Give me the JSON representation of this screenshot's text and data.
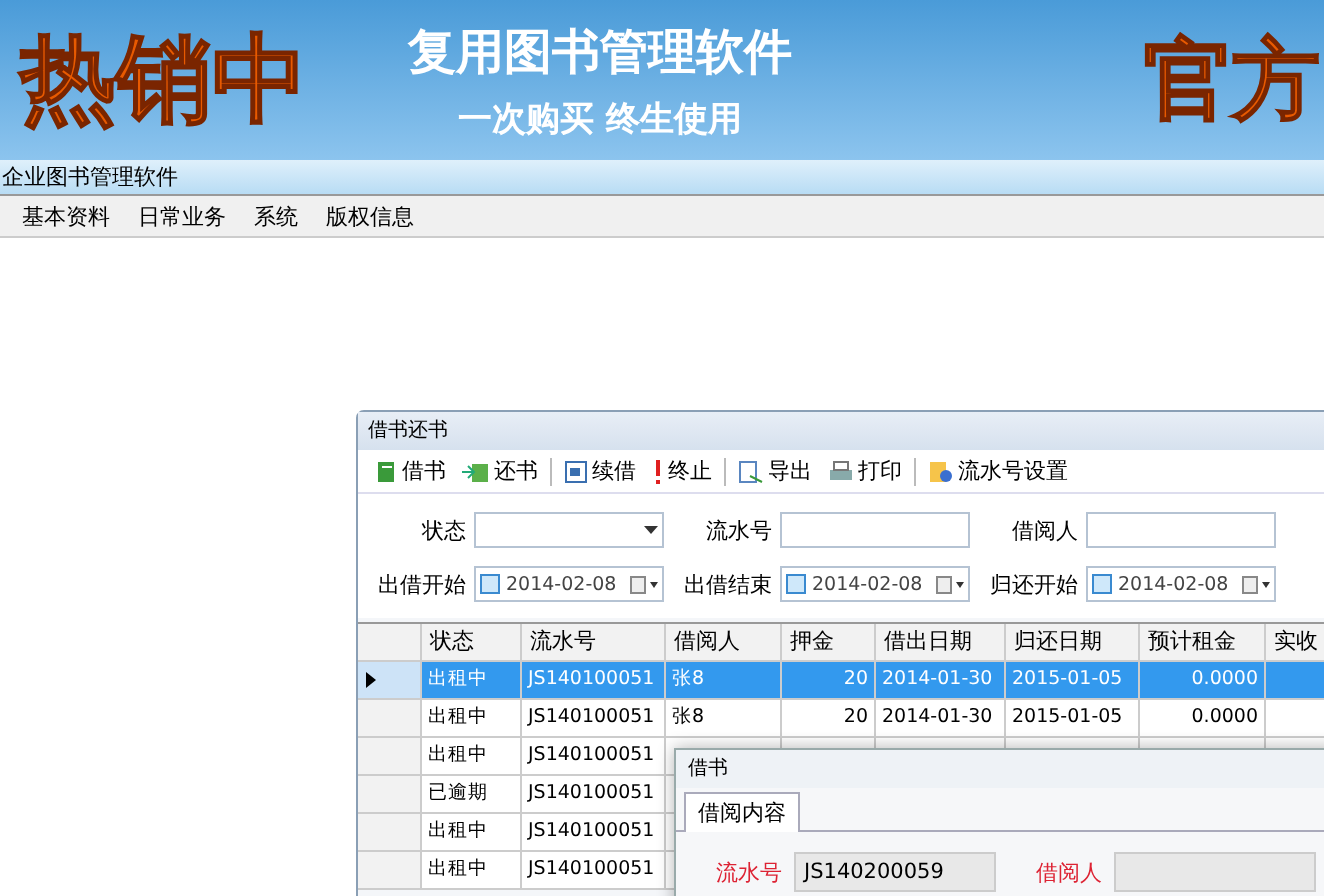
{
  "banner": {
    "slogan": "热销中",
    "title": "复用图书管理软件",
    "subtitle": "一次购买 终生使用",
    "badge": "官方"
  },
  "app_title": "企业图书管理软件",
  "menu": [
    "基本资料",
    "日常业务",
    "系统",
    "版权信息"
  ],
  "window": {
    "title": "借书还书",
    "toolbar": [
      {
        "label": "借书",
        "separator_after": false
      },
      {
        "label": "还书",
        "separator_after": true
      },
      {
        "label": "续借",
        "separator_after": false
      },
      {
        "label": "终止",
        "separator_after": true
      },
      {
        "label": "导出",
        "separator_after": false
      },
      {
        "label": "打印",
        "separator_after": true
      },
      {
        "label": "流水号设置",
        "separator_after": false
      }
    ],
    "filters": [
      {
        "label": "状态",
        "kind": "combo"
      },
      {
        "label": "流水号",
        "kind": "text"
      },
      {
        "label": "借阅人",
        "kind": "text"
      },
      {
        "label": "出借开始",
        "kind": "date",
        "value": "2014-02-08"
      },
      {
        "label": "出借结束",
        "kind": "date",
        "value": "2014-02-08"
      },
      {
        "label": "归还开始",
        "kind": "date",
        "value": "2014-02-08"
      }
    ],
    "table": {
      "columns": [
        "状态",
        "流水号",
        "借阅人",
        "押金",
        "借出日期",
        "归还日期",
        "预计租金",
        "实收"
      ],
      "rows": [
        {
          "selected": true,
          "cells": [
            "出租中",
            "JS140100051",
            "张8",
            "20",
            "2014-01-30",
            "2015-01-05",
            "0.0000"
          ]
        },
        {
          "selected": false,
          "cells": [
            "出租中",
            "JS140100051",
            "张8",
            "20",
            "2014-01-30",
            "2015-01-05",
            "0.0000"
          ]
        },
        {
          "selected": false,
          "cells": [
            "出租中",
            "JS140100051"
          ]
        },
        {
          "selected": false,
          "cells": [
            "已逾期",
            "JS140100051"
          ]
        },
        {
          "selected": false,
          "cells": [
            "出租中",
            "JS140100051"
          ]
        },
        {
          "selected": false,
          "cells": [
            "出租中",
            "JS140100051"
          ]
        }
      ]
    }
  },
  "dialog": {
    "title": "借书",
    "tabs": [
      {
        "label": "借阅内容",
        "selected": true
      }
    ],
    "fields": [
      {
        "label": "流水号",
        "value": "JS140200059"
      },
      {
        "label": "借阅人"
      }
    ]
  }
}
